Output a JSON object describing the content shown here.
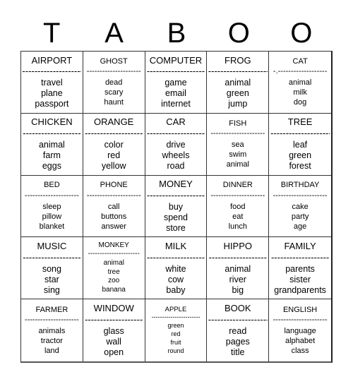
{
  "title_letters": [
    "T",
    "A",
    "B",
    "O",
    "O"
  ],
  "cells": [
    {
      "word": "AIRPORT",
      "sep": "--------------------",
      "hints": [
        "travel",
        "plane",
        "passport"
      ],
      "size": "lg"
    },
    {
      "word": "GHOST",
      "sep": "---------------------",
      "hints": [
        "dead",
        "scary",
        "haunt"
      ],
      "size": "md"
    },
    {
      "word": "COMPUTER",
      "sep": "-------------------",
      "hints": [
        "game",
        "email",
        "internet"
      ],
      "size": "lg"
    },
    {
      "word": "FROG",
      "sep": "--------------------",
      "hints": [
        "animal",
        "green",
        "jump"
      ],
      "size": "lg"
    },
    {
      "word": "CAT",
      "sep": "-.-------------------",
      "hints": [
        "animal",
        "milk",
        "dog"
      ],
      "size": "md"
    },
    {
      "word": "CHICKEN",
      "sep": "-------------------",
      "hints": [
        "animal",
        "farm",
        "eggs"
      ],
      "size": "lg"
    },
    {
      "word": "ORANGE",
      "sep": "-------------------",
      "hints": [
        "color",
        "red",
        "yellow"
      ],
      "size": "lg"
    },
    {
      "word": "CAR",
      "sep": "-------------------",
      "hints": [
        "drive",
        "wheels",
        "road"
      ],
      "size": "lg"
    },
    {
      "word": "FISH",
      "sep": "---------------------",
      "hints": [
        "sea",
        "swim",
        "animal"
      ],
      "size": "md"
    },
    {
      "word": "TREE",
      "sep": "--------------------",
      "hints": [
        "leaf",
        "green",
        "forest"
      ],
      "size": "lg"
    },
    {
      "word": "BED",
      "sep": "---------------------",
      "hints": [
        "sleep",
        "pillow",
        "blanket"
      ],
      "size": "md"
    },
    {
      "word": "PHONE",
      "sep": "---------------------",
      "hints": [
        "call",
        "buttons",
        "answer"
      ],
      "size": "md"
    },
    {
      "word": "MONEY",
      "sep": "-------------------",
      "hints": [
        "buy",
        "spend",
        "store"
      ],
      "size": "lg"
    },
    {
      "word": "DINNER",
      "sep": "---------------------",
      "hints": [
        "food",
        "eat",
        "lunch"
      ],
      "size": "md"
    },
    {
      "word": "BIRTHDAY",
      "sep": "---------------------",
      "hints": [
        "cake",
        "party",
        "age"
      ],
      "size": "md"
    },
    {
      "word": "MUSIC",
      "sep": "-------------------",
      "hints": [
        "song",
        "star",
        "sing"
      ],
      "size": "lg"
    },
    {
      "word": "MONKEY",
      "sep": "----------------------",
      "hints": [
        "animal",
        "tree",
        "zoo",
        "banana"
      ],
      "size": "sm"
    },
    {
      "word": "MILK",
      "sep": "-------------------",
      "hints": [
        "white",
        "cow",
        "baby"
      ],
      "size": "lg"
    },
    {
      "word": "HIPPO",
      "sep": "-------------------",
      "hints": [
        "animal",
        "river",
        "big"
      ],
      "size": "lg"
    },
    {
      "word": "FAMILY",
      "sep": "-------------------",
      "hints": [
        "parents",
        "sister",
        "grandparents"
      ],
      "size": "lg"
    },
    {
      "word": "FARMER",
      "sep": "---------------------",
      "hints": [
        "animals",
        "tractor",
        "land"
      ],
      "size": "md"
    },
    {
      "word": "WINDOW",
      "sep": "-------------------",
      "hints": [
        "glass",
        "wall",
        "open"
      ],
      "size": "lg"
    },
    {
      "word": "APPLE",
      "sep": "-----------------------",
      "hints": [
        "green",
        "red",
        "fruit",
        "round"
      ],
      "size": "xs"
    },
    {
      "word": "BOOK",
      "sep": "--------------------",
      "hints": [
        "read",
        "pages",
        "title"
      ],
      "size": "lg"
    },
    {
      "word": "ENGLISH",
      "sep": "---------------------",
      "hints": [
        "language",
        "alphabet",
        "class"
      ],
      "size": "md"
    }
  ]
}
